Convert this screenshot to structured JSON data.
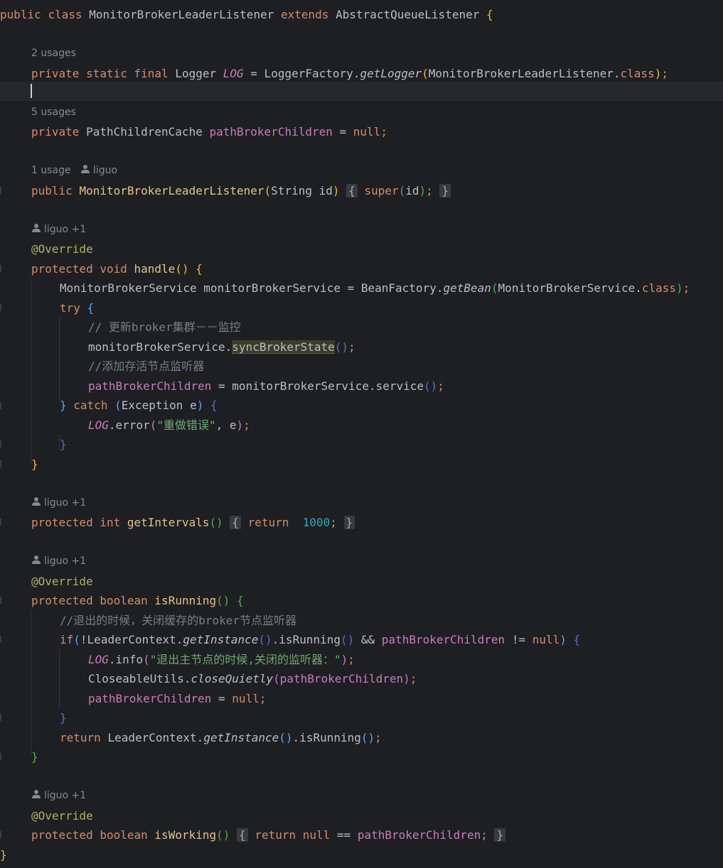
{
  "editor": {
    "colors": {
      "background": "#1e1f22",
      "keyword": "#cf8e6d",
      "method_decl": "#56a8f5",
      "field": "#c77dbb",
      "string": "#6aab73",
      "number": "#2aacb8",
      "annotation": "#b3ae60",
      "comment": "#7a7e85"
    },
    "tokens": {
      "kw_public": "public",
      "kw_class": "class",
      "kw_extends": "extends",
      "kw_private": "private",
      "kw_static": "static",
      "kw_final": "final",
      "kw_protected": "protected",
      "kw_void": "void",
      "kw_int": "int",
      "kw_boolean": "boolean",
      "kw_try": "try",
      "kw_catch": "catch",
      "kw_return": "return",
      "kw_if": "if",
      "kw_super": "super",
      "kw_class_lit": "class",
      "null": "null",
      "class_name": "MonitorBrokerLeaderListener",
      "super_class": "AbstractQueueListener",
      "type_logger": "Logger",
      "field_log": "LOG",
      "logger_factory": "LoggerFactory",
      "get_logger": "getLogger",
      "type_cache": "PathChildrenCache",
      "field_children": "pathBrokerChildren",
      "type_string": "String",
      "param_id": "id",
      "annotation_override": "@Override",
      "method_handle": "handle",
      "type_service": "MonitorBrokerService",
      "var_service": "monitorBrokerService",
      "bean_factory": "BeanFactory",
      "get_bean": "getBean",
      "comment_update": "// 更新broker集群－－监控",
      "method_sync": "syncBrokerState",
      "comment_add": "//添加存活节点监听器",
      "method_service": "service",
      "type_exception": "Exception",
      "param_e": "e",
      "method_error": "error",
      "str_error": "\"重做错误\"",
      "method_get_intervals": "getIntervals",
      "num_1000": "1000",
      "method_is_running": "isRunning",
      "comment_exit": "//退出的时候，关闭缓存的broker节点监听器",
      "leader_context": "LeaderContext",
      "get_instance": "getInstance",
      "method_info": "info",
      "str_info": "\"退出主节点的时候,关闭的监听器：\"",
      "closeable_utils": "CloseableUtils",
      "close_quietly": "closeQuietly",
      "method_is_working": "isWorking"
    },
    "hints": {
      "usages_2": "2 usages",
      "usages_5": "5 usages",
      "usage_1": "1 usage",
      "author": "liguo",
      "author_plus": "liguo +1"
    }
  }
}
